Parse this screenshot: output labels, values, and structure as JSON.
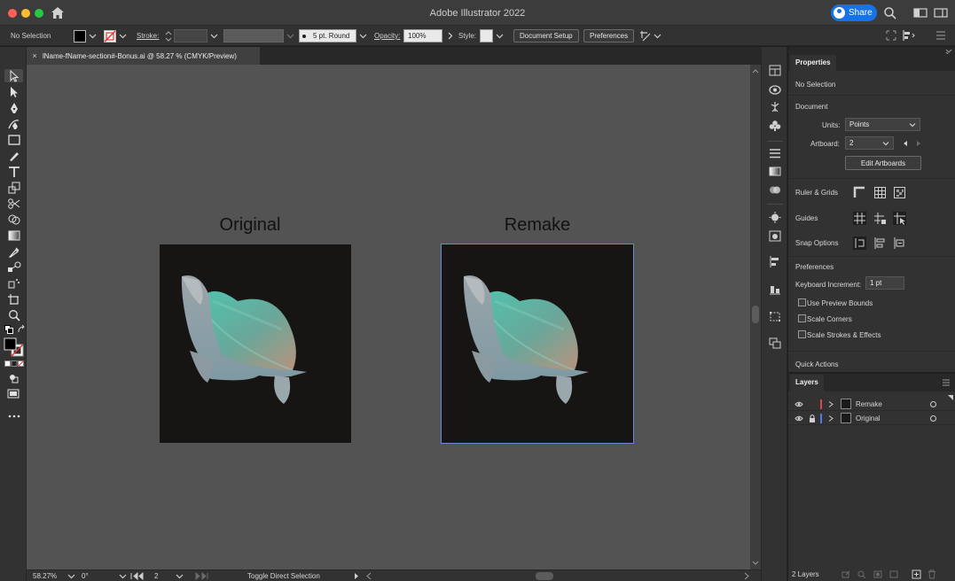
{
  "window": {
    "title": "Adobe Illustrator 2022",
    "share_label": "Share"
  },
  "icons": {
    "home": "home-icon",
    "search": "search-icon",
    "arrange": "arrange-documents-icon",
    "workspace": "workspace-switcher-icon",
    "share_avatar": "user-avatar-icon"
  },
  "control_bar": {
    "selection_status": "No Selection",
    "stroke_label": "Stroke:",
    "brush_label": "5 pt. Round",
    "opacity_label": "Opacity:",
    "opacity_value": "100%",
    "style_label": "Style:",
    "document_setup": "Document Setup",
    "preferences": "Preferences"
  },
  "document": {
    "tab_label": "lName-fName-section#-Bonus.ai @ 58.27 % (CMYK/Preview)",
    "close_symbol": "×"
  },
  "artboards": [
    {
      "label": "Original"
    },
    {
      "label": "Remake"
    }
  ],
  "status_bar": {
    "zoom": "58.27%",
    "rotation": "0°",
    "artboard_number": "2",
    "tool_hint": "Toggle Direct Selection"
  },
  "properties_panel": {
    "tab": "Properties",
    "selection_status": "No Selection",
    "document_heading": "Document",
    "units_label": "Units:",
    "units_value": "Points",
    "artboard_label": "Artboard:",
    "artboard_value": "2",
    "edit_artboards": "Edit Artboards",
    "ruler_grids": "Ruler & Grids",
    "guides": "Guides",
    "snap_options": "Snap Options",
    "preferences_heading": "Preferences",
    "keyboard_increment_label": "Keyboard Increment:",
    "keyboard_increment_value": "1 pt",
    "checkboxes": [
      {
        "label": "Use Preview Bounds",
        "checked": false
      },
      {
        "label": "Scale Corners",
        "checked": false
      },
      {
        "label": "Scale Strokes & Effects",
        "checked": false
      }
    ],
    "quick_actions": "Quick Actions"
  },
  "layers_panel": {
    "tab": "Layers",
    "layers": [
      {
        "name": "Remake",
        "visible": true,
        "locked": false,
        "color": "#e0454a"
      },
      {
        "name": "Original",
        "visible": true,
        "locked": true,
        "color": "#4e7be6"
      }
    ],
    "count_label": "2 Layers"
  },
  "colors": {
    "accent": "#1473e6",
    "canvas": "#535353",
    "panel": "#323232",
    "artboard": "#171514"
  }
}
